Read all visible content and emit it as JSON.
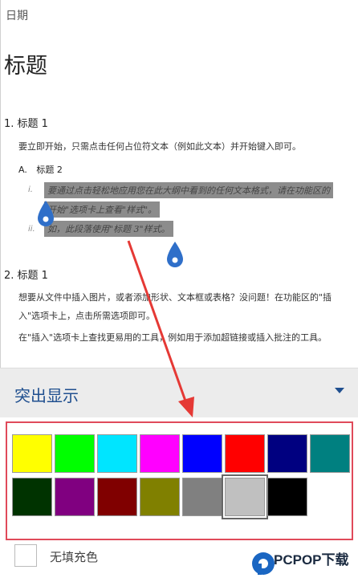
{
  "document": {
    "date_label": "日期",
    "title": "标题",
    "section1": {
      "number": "1.",
      "heading": "标题 1",
      "body": "要立即开始，只需点击任何占位符文本（例如此文本）并开始键入即可。",
      "sub": {
        "number": "A.",
        "heading": "标题 2",
        "items": [
          {
            "roman": "i.",
            "lines": [
              "要通过点击轻松地应用您在此大纲中看到的任何文本格式，请在功能区的",
              "开始\"选项卡上查看\"样式\"。"
            ]
          },
          {
            "roman": "ii.",
            "lines": [
              "如，此段落使用\"标题 3\"样式。"
            ]
          }
        ]
      }
    },
    "section2": {
      "number": "2.",
      "heading": "标题 1",
      "body_lines": [
        "想要从文件中插入图片，或者添加形状、文本框或表格？没问题！在功能区的\"插",
        "入\"选项卡上，点击所需选项即可。",
        "在\"插入\"选项卡上查找更易用的工具，例如用于添加超链接或插入批注的工具。"
      ]
    }
  },
  "highlight_panel": {
    "label": "突出显示",
    "chevron_icon": "chevron-down-icon",
    "accent_color": "#1f4f8f",
    "swatches": [
      [
        "#ffff00",
        "#00ff00",
        "#00e5ff",
        "#ff00ff",
        "#0000ff",
        "#ff0000",
        "#000080",
        "#008080"
      ],
      [
        "#003300",
        "#800080",
        "#800000",
        "#808000",
        "#808080",
        "#c0c0c0",
        "#000000"
      ]
    ],
    "selected_swatch": "#c0c0c0",
    "no_fill_label": "无填充色"
  },
  "watermark": {
    "text": "PCPOP下载",
    "icon": "pcpop-logo-icon"
  }
}
